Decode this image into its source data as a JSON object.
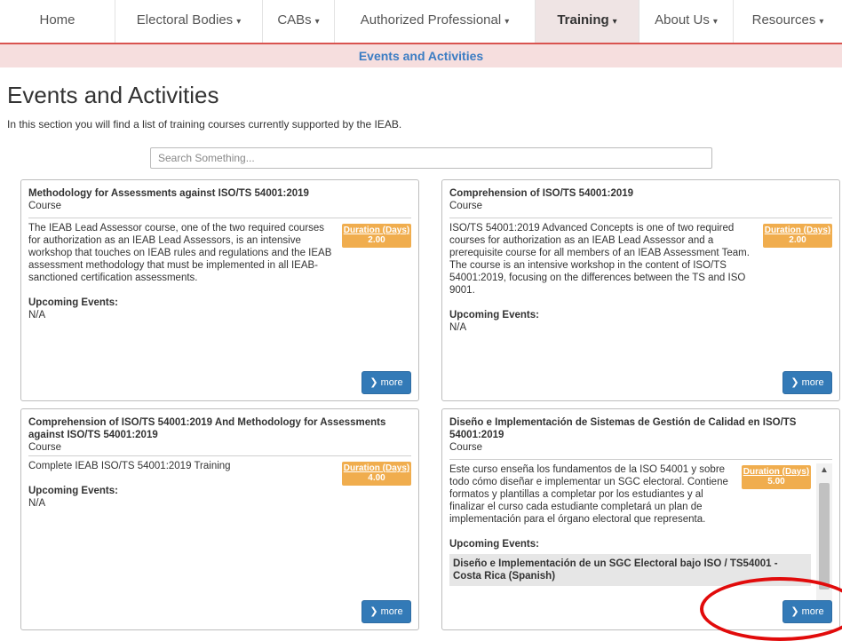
{
  "nav": {
    "items": [
      {
        "label": "Home",
        "caret": ""
      },
      {
        "label": "Electoral Bodies",
        "caret": "▾"
      },
      {
        "label": "CABs",
        "caret": "▾"
      },
      {
        "label": "Authorized Professional",
        "caret": "▾"
      },
      {
        "label": "Training",
        "caret": "▾"
      },
      {
        "label": "About Us",
        "caret": "▾"
      },
      {
        "label": "Resources",
        "caret": "▾"
      }
    ],
    "active": "Training",
    "sub_label": "Events and Activities"
  },
  "page": {
    "title": "Events and Activities",
    "intro": "In this section you will find a list of training courses currently supported by the IEAB."
  },
  "search": {
    "placeholder": "Search Something..."
  },
  "cards": [
    {
      "title": "Methodology for Assessments against ISO/TS 54001:2019",
      "type": "Course",
      "description": "The IEAB Lead Assessor course, one of the two required courses for authorization as an IEAB Lead Assessors, is an intensive workshop that touches on IEAB rules and regulations and the IEAB assessment methodology that must be implemented in all IEAB-sanctioned certification assessments.",
      "duration_label": "Duration (Days)",
      "duration_value": "2.00",
      "upcoming_label": "Upcoming Events:",
      "upcoming_value": "N/A",
      "more_label": "more"
    },
    {
      "title": "Comprehension of ISO/TS 54001:2019",
      "type": "Course",
      "description": "ISO/TS 54001:2019 Advanced Concepts is one of two required courses for authorization as an IEAB Lead Assessor and a prerequisite course for all members of an IEAB Assessment Team. The course is an intensive workshop in the content of ISO/TS 54001:2019, focusing on the differences between the TS and ISO 9001.",
      "duration_label": "Duration (Days)",
      "duration_value": "2.00",
      "upcoming_label": "Upcoming Events:",
      "upcoming_value": "N/A",
      "more_label": "more"
    },
    {
      "title": "Comprehension of ISO/TS 54001:2019 And Methodology for Assessments against ISO/TS 54001:2019",
      "type": "Course",
      "description": "Complete IEAB ISO/TS 54001:2019 Training",
      "duration_label": "Duration (Days)",
      "duration_value": "4.00",
      "upcoming_label": "Upcoming Events:",
      "upcoming_value": "N/A",
      "more_label": "more"
    },
    {
      "title": "Diseño e Implementación de Sistemas de Gestión de Calidad en ISO/TS 54001:2019",
      "type": "Course",
      "description": "Este curso enseña los fundamentos de la ISO 54001 y sobre todo cómo diseñar e implementar un SGC electoral. Contiene formatos y plantillas a completar por los estudiantes y al finalizar el curso cada estudiante completará un plan de implementación para el órgano electoral que representa.",
      "duration_label": "Duration (Days)",
      "duration_value": "5.00",
      "upcoming_label": "Upcoming Events:",
      "upcoming_event": "Diseño e Implementación de un SGC Electoral bajo ISO / TS54001 - Costa Rica (Spanish)",
      "more_label": "more"
    }
  ],
  "icons": {
    "more": "chevron-right-icon",
    "scroll_up": "chevron-up-icon",
    "scroll_down": "chevron-down-icon"
  },
  "colors": {
    "accent_red": "#d9534f",
    "link_blue": "#3a7cc3",
    "button_blue": "#337ab7",
    "duration_orange": "#f0ad4e",
    "annotation_circle": "#e10b0b"
  }
}
